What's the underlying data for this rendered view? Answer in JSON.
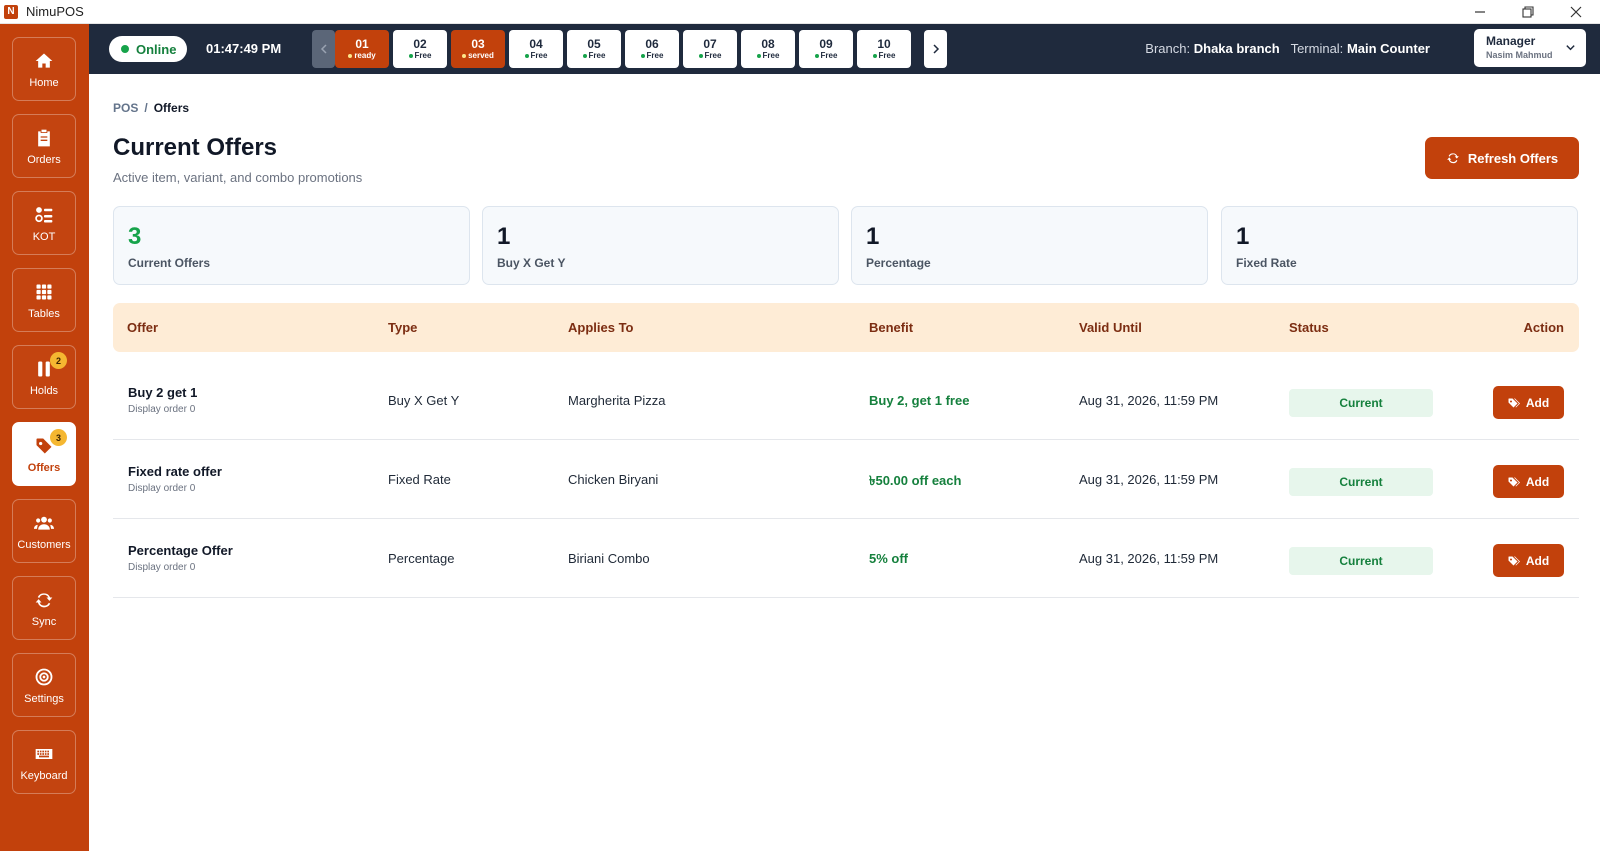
{
  "app": {
    "logo_letter": "N",
    "title": "NimuPOS"
  },
  "sidebar": {
    "items": [
      {
        "label": "Home"
      },
      {
        "label": "Orders"
      },
      {
        "label": "KOT"
      },
      {
        "label": "Tables"
      },
      {
        "label": "Holds",
        "badge": "2"
      },
      {
        "label": "Offers",
        "badge": "3"
      },
      {
        "label": "Customers"
      },
      {
        "label": "Sync"
      },
      {
        "label": "Settings"
      },
      {
        "label": "Keyboard"
      }
    ],
    "active": "Offers",
    "color": "#c2410c"
  },
  "topbar": {
    "status": "Online",
    "time": "01:47:49 PM",
    "tables": [
      {
        "num": "01",
        "status": "ready"
      },
      {
        "num": "02",
        "status": "Free"
      },
      {
        "num": "03",
        "status": "served"
      },
      {
        "num": "04",
        "status": "Free"
      },
      {
        "num": "05",
        "status": "Free"
      },
      {
        "num": "06",
        "status": "Free"
      },
      {
        "num": "07",
        "status": "Free"
      },
      {
        "num": "08",
        "status": "Free"
      },
      {
        "num": "09",
        "status": "Free"
      },
      {
        "num": "10",
        "status": "Free"
      }
    ],
    "branch_label": "Branch:",
    "branch": "Dhaka branch",
    "terminal_label": "Terminal:",
    "terminal": "Main Counter",
    "user_role": "Manager",
    "user_name": "Nasim Mahmud",
    "color": "#1f2a3d"
  },
  "main": {
    "breadcrumb": {
      "root": "POS",
      "sep": "/",
      "current": "Offers"
    },
    "title": "Current Offers",
    "subtitle": "Active item, variant, and combo promotions",
    "refresh_label": "Refresh Offers",
    "stats": [
      {
        "value": "3",
        "label": "Current Offers"
      },
      {
        "value": "1",
        "label": "Buy X Get Y"
      },
      {
        "value": "1",
        "label": "Percentage"
      },
      {
        "value": "1",
        "label": "Fixed Rate"
      }
    ],
    "table": {
      "headers": [
        "Offer",
        "Type",
        "Applies To",
        "Benefit",
        "Valid Until",
        "Status",
        "Action"
      ],
      "rows": [
        {
          "name": "Buy 2 get 1",
          "order": "Display order 0",
          "type": "Buy X Get Y",
          "applies_to": "Margherita Pizza",
          "benefit": "Buy 2, get 1 free",
          "valid_until": "Aug 31, 2026, 11:59 PM",
          "status": "Current",
          "action": "Add"
        },
        {
          "name": "Fixed rate offer",
          "order": "Display order 0",
          "type": "Fixed Rate",
          "applies_to": "Chicken Biryani",
          "benefit": "৳50.00 off each",
          "valid_until": "Aug 31, 2026, 11:59 PM",
          "status": "Current",
          "action": "Add"
        },
        {
          "name": "Percentage Offer",
          "order": "Display order 0",
          "type": "Percentage",
          "applies_to": "Biriani Combo",
          "benefit": "5% off",
          "valid_until": "Aug 31, 2026, 11:59 PM",
          "status": "Current",
          "action": "Add"
        }
      ]
    }
  }
}
